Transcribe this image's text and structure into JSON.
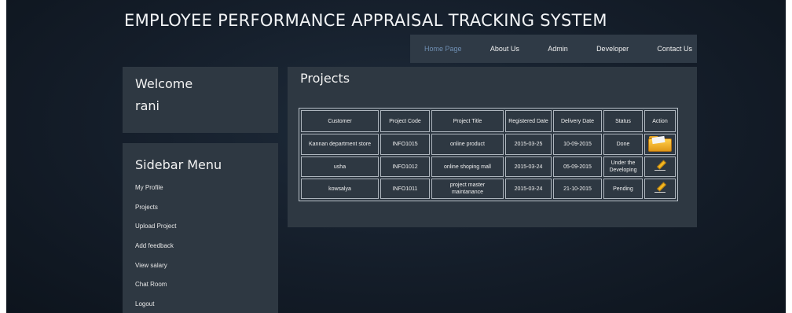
{
  "site": {
    "title": "EMPLOYEE PERFORMANCE APPRAISAL TRACKING SYSTEM"
  },
  "nav": {
    "items": [
      {
        "label": "Home Page",
        "active": true
      },
      {
        "label": "About Us",
        "active": false
      },
      {
        "label": "Admin",
        "active": false
      },
      {
        "label": "Developer",
        "active": false
      },
      {
        "label": "Contact Us",
        "active": false
      }
    ]
  },
  "welcome": {
    "greeting": "Welcome",
    "username": "rani"
  },
  "sidebar": {
    "heading": "Sidebar Menu",
    "items": [
      {
        "label": "My Profile"
      },
      {
        "label": "Projects"
      },
      {
        "label": "Upload Project"
      },
      {
        "label": "Add feedback"
      },
      {
        "label": "View salary"
      },
      {
        "label": "Chat Room"
      },
      {
        "label": "Logout"
      }
    ]
  },
  "main": {
    "heading": "Projects",
    "table": {
      "headers": [
        "Customer",
        "Project Code",
        "Project Title",
        "Registered Date",
        "Delivery Date",
        "Status",
        "Action"
      ],
      "rows": [
        {
          "customer": "Kannan department store",
          "code": "INFO1015",
          "title": "online product",
          "registered": "2015-03-25",
          "delivery": "10-09-2015",
          "status": "Done",
          "action_icon": "folder-icon"
        },
        {
          "customer": "usha",
          "code": "INFO1012",
          "title": "online shoping mall",
          "registered": "2015-03-24",
          "delivery": "05-09-2015",
          "status": "Under the Developing",
          "action_icon": "edit-pencil-icon"
        },
        {
          "customer": "kowsalya",
          "code": "INFO1011",
          "title": "project master maintanance",
          "registered": "2015-03-24",
          "delivery": "21-10-2015",
          "status": "Pending",
          "action_icon": "edit-pencil-icon"
        }
      ]
    }
  },
  "colors": {
    "background": "#141d29",
    "panel": "#2e3842",
    "nav_bar": "#2f3a46",
    "active_nav": "#6f8fb3",
    "text": "#f2f2f2"
  }
}
